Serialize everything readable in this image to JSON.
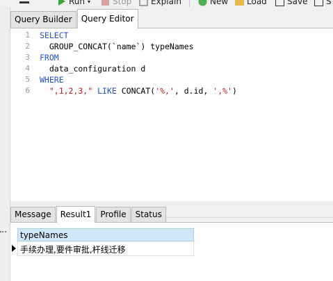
{
  "toolbar": {
    "run_label": "Run",
    "stop_label": "Stop",
    "explain_label": "Explain",
    "new_label": "New",
    "load_label": "Load",
    "save_label": "Save",
    "saveas_label": "S"
  },
  "query_tabs": [
    {
      "label": "Query Builder",
      "active": false
    },
    {
      "label": "Query Editor",
      "active": true
    }
  ],
  "editor": {
    "line_numbers": [
      "1",
      "2",
      "3",
      "4",
      "5",
      "6"
    ],
    "lines": [
      {
        "parts": [
          {
            "t": "SELECT",
            "k": "kw"
          }
        ]
      },
      {
        "parts": [
          {
            "t": "  GROUP_CONCAT(`name`) typeNames",
            "k": "plain"
          }
        ]
      },
      {
        "parts": [
          {
            "t": "FROM",
            "k": "kw"
          }
        ]
      },
      {
        "parts": [
          {
            "t": "  data_configuration d",
            "k": "plain"
          }
        ]
      },
      {
        "parts": [
          {
            "t": "WHERE",
            "k": "kw"
          }
        ]
      },
      {
        "parts": [
          {
            "t": "  \",1,2,3,\"",
            "k": "str"
          },
          {
            "t": " LIKE ",
            "k": "kw"
          },
          {
            "t": "CONCAT(",
            "k": "plain"
          },
          {
            "t": "'%,'",
            "k": "str"
          },
          {
            "t": ", d.id, ",
            "k": "plain"
          },
          {
            "t": "',%'",
            "k": "str"
          },
          {
            "t": ")",
            "k": "plain"
          }
        ]
      }
    ]
  },
  "result_tabs": [
    {
      "label": "Message",
      "active": false
    },
    {
      "label": "Result1",
      "active": true
    },
    {
      "label": "Profile",
      "active": false
    },
    {
      "label": "Status",
      "active": false
    }
  ],
  "grid": {
    "column_header": "typeNames",
    "rows": [
      "手续办理,要件审批,杆线迁移"
    ]
  },
  "colors": {
    "keyword": "#2452c6",
    "string": "#c41a16",
    "header_bg": "#cfe7f6"
  }
}
